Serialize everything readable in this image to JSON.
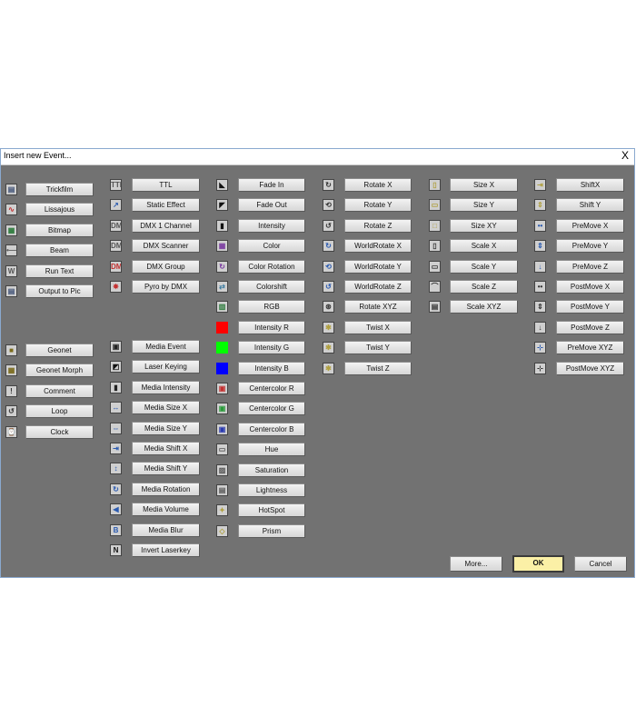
{
  "window": {
    "title": "Insert new Event...",
    "close_label": "X"
  },
  "columns": [
    {
      "id": "col1",
      "groups": [
        {
          "items": [
            {
              "label": "Trickfilm",
              "icon": "film-strip-icon",
              "color": "#3c4e74",
              "glyph": "▤"
            },
            {
              "label": "Lissajous",
              "icon": "lissajous-icon",
              "color": "#c43030",
              "glyph": "∿"
            },
            {
              "label": "Bitmap",
              "icon": "bitmap-icon",
              "color": "#2a7a3a",
              "glyph": "▦"
            },
            {
              "label": "Beam",
              "icon": "beam-icon",
              "color": "#555555",
              "glyph": "•—"
            },
            {
              "label": "Run Text",
              "icon": "run-text-icon",
              "color": "#555555",
              "glyph": "W"
            },
            {
              "label": "Output to Pic",
              "icon": "output-to-pic-icon",
              "color": "#3c4e74",
              "glyph": "▤"
            }
          ]
        },
        {
          "items": [
            {
              "label": "Geonet",
              "icon": "geonet-icon",
              "color": "#7a6a1a",
              "glyph": "■"
            },
            {
              "label": "Geonet Morph",
              "icon": "geonet-morph-icon",
              "color": "#7a6a1a",
              "glyph": "▦"
            },
            {
              "label": "Comment",
              "icon": "comment-icon",
              "color": "#333333",
              "glyph": "!"
            },
            {
              "label": "Loop",
              "icon": "loop-icon",
              "color": "#333333",
              "glyph": "↺"
            },
            {
              "label": "Clock",
              "icon": "clock-icon",
              "color": "#333333",
              "glyph": "⌚"
            }
          ]
        }
      ]
    },
    {
      "id": "col2",
      "groups": [
        {
          "items": [
            {
              "label": "TTL",
              "icon": "ttl-icon",
              "color": "#555555",
              "glyph": "TTL"
            },
            {
              "label": "Static Effect",
              "icon": "static-effect-icon",
              "color": "#2a5ab0",
              "glyph": "↗"
            },
            {
              "label": "DMX 1 Channel",
              "icon": "dmx-channel-icon",
              "color": "#555555",
              "glyph": "DMX"
            },
            {
              "label": "DMX Scanner",
              "icon": "dmx-scanner-icon",
              "color": "#555555",
              "glyph": "DMX"
            },
            {
              "label": "DMX Group",
              "icon": "dmx-group-icon",
              "color": "#c43030",
              "glyph": "DMX"
            },
            {
              "label": "Pyro by DMX",
              "icon": "pyro-icon",
              "color": "#c43030",
              "glyph": "✸"
            }
          ]
        },
        {
          "items": [
            {
              "label": "Media Event",
              "icon": "media-event-icon",
              "color": "#222222",
              "glyph": "▣"
            },
            {
              "label": "Laser Keying",
              "icon": "laser-keying-icon",
              "color": "#111111",
              "glyph": "◩"
            },
            {
              "label": "Media Intensity",
              "icon": "media-intensity-icon",
              "color": "#222222",
              "glyph": "▮"
            },
            {
              "label": "Media Size X",
              "icon": "media-size-x-icon",
              "color": "#2a5ab0",
              "glyph": "↔"
            },
            {
              "label": "Media Size Y",
              "icon": "media-size-y-icon",
              "color": "#2a5ab0",
              "glyph": "⇔"
            },
            {
              "label": "Media Shift X",
              "icon": "media-shift-x-icon",
              "color": "#2a5ab0",
              "glyph": "⇥"
            },
            {
              "label": "Media Shift Y",
              "icon": "media-shift-y-icon",
              "color": "#2a5ab0",
              "glyph": "↕"
            },
            {
              "label": "Media Rotation",
              "icon": "media-rotation-icon",
              "color": "#2a5ab0",
              "glyph": "↻"
            },
            {
              "label": "Media Volume",
              "icon": "media-volume-icon",
              "color": "#2a5ab0",
              "glyph": "◀"
            },
            {
              "label": "Media Blur",
              "icon": "media-blur-icon",
              "color": "#2a5ab0",
              "glyph": "B"
            },
            {
              "label": "Invert Laserkey",
              "icon": "invert-laserkey-icon",
              "color": "#111111",
              "glyph": "N"
            }
          ]
        }
      ]
    },
    {
      "id": "col3",
      "groups": [
        {
          "items": [
            {
              "label": "Fade In",
              "icon": "fade-in-icon",
              "color": "#111111",
              "glyph": "◣"
            },
            {
              "label": "Fade Out",
              "icon": "fade-out-icon",
              "color": "#111111",
              "glyph": "◤"
            },
            {
              "label": "Intensity",
              "icon": "intensity-icon",
              "color": "#111111",
              "glyph": "▮"
            },
            {
              "label": "Color",
              "icon": "color-icon",
              "color": "#7a3aa0",
              "glyph": "▦"
            },
            {
              "label": "Color Rotation",
              "icon": "color-rotation-icon",
              "color": "#7a3aa0",
              "glyph": "↻"
            },
            {
              "label": "Colorshift",
              "icon": "colorshift-icon",
              "color": "#3a7aa0",
              "glyph": "⇄"
            },
            {
              "label": "RGB",
              "icon": "rgb-icon",
              "color": "#2a7a3a",
              "glyph": "▥"
            },
            {
              "label": "Intensity R",
              "icon": "intensity-r-icon",
              "color": "#ff0000",
              "glyph": "",
              "solid": true
            },
            {
              "label": "Intensity G",
              "icon": "intensity-g-icon",
              "color": "#00ff00",
              "glyph": "",
              "solid": true
            },
            {
              "label": "Intensity B",
              "icon": "intensity-b-icon",
              "color": "#0000ff",
              "glyph": "",
              "solid": true
            },
            {
              "label": "Centercolor R",
              "icon": "centercolor-r-icon",
              "color": "#c43030",
              "glyph": "▣"
            },
            {
              "label": "Centercolor G",
              "icon": "centercolor-g-icon",
              "color": "#2a9a3a",
              "glyph": "▣"
            },
            {
              "label": "Centercolor B",
              "icon": "centercolor-b-icon",
              "color": "#2a3ab0",
              "glyph": "▣"
            },
            {
              "label": "Hue",
              "icon": "hue-icon",
              "color": "#555555",
              "glyph": "▭"
            },
            {
              "label": "Saturation",
              "icon": "saturation-icon",
              "color": "#555555",
              "glyph": "▨"
            },
            {
              "label": "Lightness",
              "icon": "lightness-icon",
              "color": "#555555",
              "glyph": "▤"
            },
            {
              "label": "HotSpot",
              "icon": "hotspot-icon",
              "color": "#b0a040",
              "glyph": "✦"
            },
            {
              "label": "Prism",
              "icon": "prism-icon",
              "color": "#b0a040",
              "glyph": "◇"
            }
          ]
        }
      ]
    },
    {
      "id": "col4",
      "groups": [
        {
          "items": [
            {
              "label": "Rotate X",
              "icon": "rotate-x-icon",
              "color": "#333333",
              "glyph": "↻"
            },
            {
              "label": "Rotate Y",
              "icon": "rotate-y-icon",
              "color": "#333333",
              "glyph": "⟲"
            },
            {
              "label": "Rotate Z",
              "icon": "rotate-z-icon",
              "color": "#333333",
              "glyph": "↺"
            },
            {
              "label": "WorldRotate X",
              "icon": "world-rotate-x-icon",
              "color": "#2a5ab0",
              "glyph": "↻"
            },
            {
              "label": "WorldRotate Y",
              "icon": "world-rotate-y-icon",
              "color": "#2a5ab0",
              "glyph": "⟲"
            },
            {
              "label": "WorldRotate Z",
              "icon": "world-rotate-z-icon",
              "color": "#2a5ab0",
              "glyph": "↺"
            },
            {
              "label": "Rotate XYZ",
              "icon": "rotate-xyz-icon",
              "color": "#333333",
              "glyph": "⊛"
            },
            {
              "label": "Twist X",
              "icon": "twist-x-icon",
              "color": "#b0a040",
              "glyph": "✱"
            },
            {
              "label": "Twist Y",
              "icon": "twist-y-icon",
              "color": "#b0a040",
              "glyph": "✱"
            },
            {
              "label": "Twist Z",
              "icon": "twist-z-icon",
              "color": "#b0a040",
              "glyph": "✱"
            }
          ]
        }
      ]
    },
    {
      "id": "col5",
      "groups": [
        {
          "items": [
            {
              "label": "Size X",
              "icon": "size-x-icon",
              "color": "#b0a040",
              "glyph": "▯"
            },
            {
              "label": "Size Y",
              "icon": "size-y-icon",
              "color": "#b0a040",
              "glyph": "▭"
            },
            {
              "label": "Size XY",
              "icon": "size-xy-icon",
              "color": "#b0a040",
              "glyph": "□"
            },
            {
              "label": "Scale X",
              "icon": "scale-x-icon",
              "color": "#333333",
              "glyph": "▯"
            },
            {
              "label": "Scale Y",
              "icon": "scale-y-icon",
              "color": "#333333",
              "glyph": "▭"
            },
            {
              "label": "Scale Z",
              "icon": "scale-z-icon",
              "color": "#333333",
              "glyph": "⌒"
            },
            {
              "label": "Scale XYZ",
              "icon": "scale-xyz-icon",
              "color": "#333333",
              "glyph": "▤"
            }
          ]
        }
      ]
    },
    {
      "id": "col6",
      "groups": [
        {
          "items": [
            {
              "label": "ShiftX",
              "icon": "shift-x-icon",
              "color": "#b0a040",
              "glyph": "⇥"
            },
            {
              "label": "Shift Y",
              "icon": "shift-y-icon",
              "color": "#b0a040",
              "glyph": "⇕"
            },
            {
              "label": "PreMove X",
              "icon": "premove-x-icon",
              "color": "#2a5ab0",
              "glyph": "••"
            },
            {
              "label": "PreMove Y",
              "icon": "premove-y-icon",
              "color": "#2a5ab0",
              "glyph": "⇕"
            },
            {
              "label": "PreMove Z",
              "icon": "premove-z-icon",
              "color": "#2a5ab0",
              "glyph": "↓"
            },
            {
              "label": "PostMove X",
              "icon": "postmove-x-icon",
              "color": "#333333",
              "glyph": "••"
            },
            {
              "label": "PostMove Y",
              "icon": "postmove-y-icon",
              "color": "#333333",
              "glyph": "⇕"
            },
            {
              "label": "PostMove Z",
              "icon": "postmove-z-icon",
              "color": "#333333",
              "glyph": "↓"
            },
            {
              "label": "PreMove XYZ",
              "icon": "premove-xyz-icon",
              "color": "#2a5ab0",
              "glyph": "⊹"
            },
            {
              "label": "PostMove XYZ",
              "icon": "postmove-xyz-icon",
              "color": "#333333",
              "glyph": "⊹"
            }
          ]
        }
      ]
    }
  ],
  "footer": {
    "more_label": "More...",
    "ok_label": "OK",
    "cancel_label": "Cancel"
  }
}
